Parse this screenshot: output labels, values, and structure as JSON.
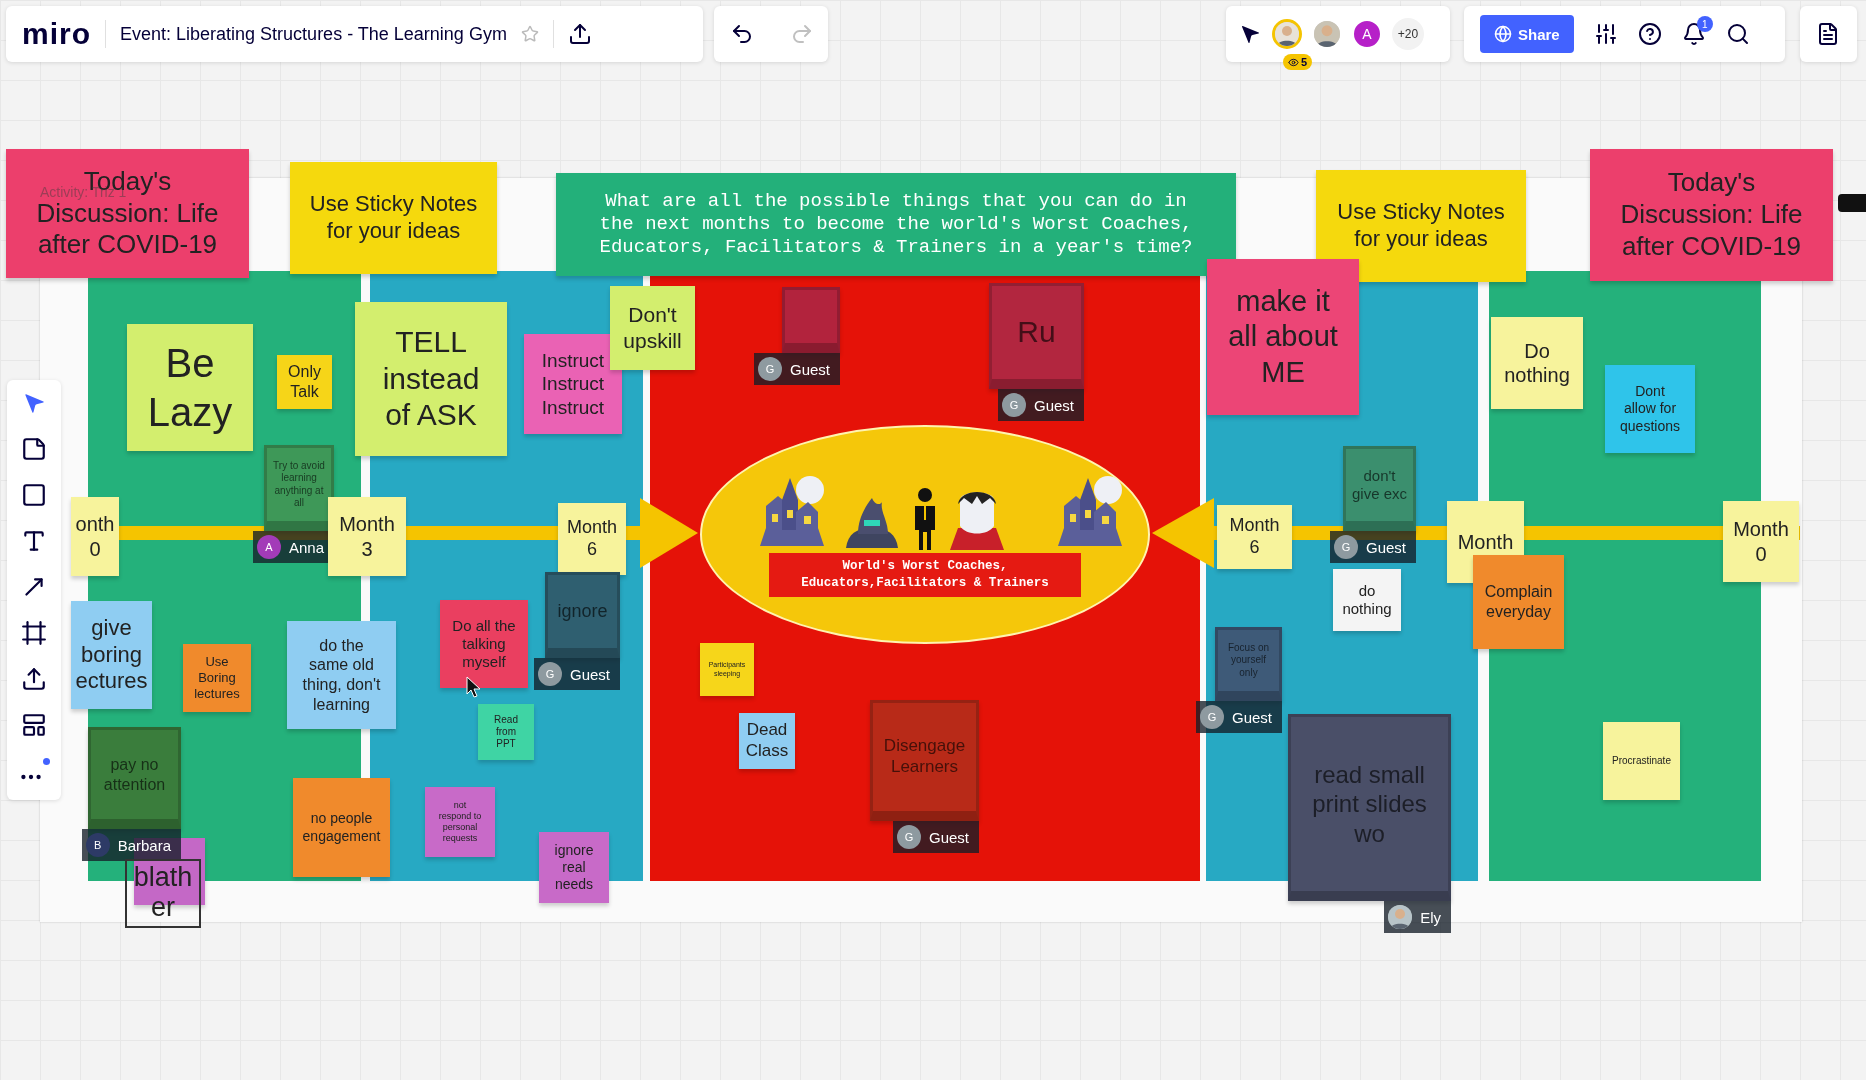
{
  "header": {
    "logo": "miro",
    "board_title": "Event: Liberating Structures - The Learning Gym",
    "starred": false
  },
  "collaborators": {
    "viewers": "5",
    "avatars": [
      {
        "kind": "photo"
      },
      {
        "kind": "photo"
      },
      {
        "kind": "initial",
        "initial": "A",
        "color": "#b620c8"
      }
    ],
    "more": "+20"
  },
  "share": {
    "label": "Share",
    "notifications": "1"
  },
  "tools": [
    {
      "kind": "select",
      "selected": true
    },
    {
      "kind": "sticky",
      "selected": false
    },
    {
      "kind": "shape",
      "selected": false
    },
    {
      "kind": "text",
      "selected": false
    },
    {
      "kind": "line",
      "selected": false
    },
    {
      "kind": "frame",
      "selected": false
    },
    {
      "kind": "upload",
      "selected": false
    },
    {
      "kind": "templates",
      "selected": false
    },
    {
      "kind": "more",
      "selected": false
    }
  ],
  "board": {
    "activity_label": "Activity: Triz 1",
    "lanes": [
      {
        "color": "#24b17b"
      },
      {
        "color": "#27a9c3"
      },
      {
        "color": "#e51208"
      },
      {
        "color": "#27a9c3"
      },
      {
        "color": "#24b17b"
      }
    ],
    "center_label": "World's Worst Coaches,\nEducators,Facilitators & Trainers",
    "notes": [
      {
        "text": "Today's\nDiscussion: Life\nafter COVID-19",
        "color": "#ec3f6c"
      },
      {
        "text": "Use Sticky Notes\nfor your ideas",
        "color": "#f5d90d"
      },
      {
        "text": "What are all the possible things that you can do in\nthe next months to become the world's Worst Coaches,\nEducators, Facilitators & Trainers in a year's time?",
        "color": "#23b07a"
      },
      {
        "text": "Use Sticky Notes\nfor your ideas",
        "color": "#f5d90d"
      },
      {
        "text": "Today's\nDiscussion: Life\nafter COVID-19",
        "color": "#ec3f6c"
      },
      {
        "text": "Be\nLazy",
        "color": "#d3ee6e"
      },
      {
        "text": "Only\nTalk",
        "color": "#f6d518"
      },
      {
        "text": "Try to avoid\nlearning\nanything at\nall",
        "color": "#3e9858",
        "author": {
          "kind": "initial",
          "name": "Anna",
          "initial": "A",
          "color": "#a33bb8"
        }
      },
      {
        "text": "TELL\ninstead\nof ASK",
        "color": "#d3ee6e"
      },
      {
        "text": "Instruct\nInstruct\nInstruct",
        "color": "#ea62b4"
      },
      {
        "text": "Don't\nupskill",
        "color": "#d3ee6e"
      },
      {
        "text": "onth\n0",
        "color": "#f7f39c"
      },
      {
        "text": "Month\n3",
        "color": "#f7f39c"
      },
      {
        "text": "Month\n6",
        "color": "#f7f39c"
      },
      {
        "text": "give\nboring\nectures",
        "color": "#8fcdf2"
      },
      {
        "text": "Use\nBoring\nlectures",
        "color": "#f08a2c"
      },
      {
        "text": "do the\nsame old\nthing, don't\nlearning",
        "color": "#8fcdf2"
      },
      {
        "text": "Do all the\ntalking\nmyself",
        "color": "#ea3f60"
      },
      {
        "text": "ignore",
        "color": "#2f5f70",
        "author": {
          "kind": "initial",
          "name": "Guest",
          "initial": "G",
          "color": "#8e9aa0"
        }
      },
      {
        "text": "Read\nfrom\nPPT",
        "color": "#3fd4a4"
      },
      {
        "color": "#c468c6"
      },
      {
        "text": "pay no\nattention",
        "color": "#3a7d3c",
        "author": {
          "kind": "initial",
          "name": "Barbara",
          "initial": "B",
          "color": "#2d3a66"
        }
      },
      {
        "text": "no people\nengagement",
        "color": "#f08a2c"
      },
      {
        "text": "not\nrespond to\npersonal\nrequests",
        "color": "#c86ac8"
      },
      {
        "text": "ignore\nreal\nneeds",
        "color": "#c86ac8"
      },
      {
        "color": "#b2233d",
        "author": {
          "kind": "initial",
          "name": "Guest",
          "initial": "G",
          "color": "#8e9aa0"
        }
      },
      {
        "text": "Ru",
        "color": "#b2263f",
        "author": {
          "kind": "initial",
          "name": "Guest",
          "initial": "G",
          "color": "#8e9aa0"
        }
      },
      {
        "text": "Participants\nsleeping",
        "color": "#f6d61a"
      },
      {
        "text": "Dead\nClass",
        "color": "#8fcdf2"
      },
      {
        "text": "Disengage\nLearners",
        "color": "#b82a18",
        "author": {
          "kind": "initial",
          "name": "Guest",
          "initial": "G",
          "color": "#8e9aa0"
        }
      },
      {
        "text": "make it\nall about\nME",
        "color": "#ec4576"
      },
      {
        "text": "Month\n6",
        "color": "#f7f39c"
      },
      {
        "text": "don't\ngive exc",
        "color": "#3b8f6e",
        "author": {
          "kind": "initial",
          "name": "Guest",
          "initial": "G",
          "color": "#8e9aa0"
        }
      },
      {
        "text": "do\nnothing",
        "color": "#f4f4f4"
      },
      {
        "text": "Focus on\nyourself\nonly",
        "color": "#3e5a78",
        "author": {
          "kind": "initial",
          "name": "Guest",
          "initial": "G",
          "color": "#8e9aa0"
        }
      },
      {
        "text": "read small\nprint slides\nwo",
        "color": "#4a4f68",
        "author": {
          "kind": "photo",
          "name": "Ely"
        }
      },
      {
        "text": "Do\nnothing",
        "color": "#f7f39c"
      },
      {
        "text": "Dont\nallow for\nquestions",
        "color": "#2fc4ea"
      },
      {
        "text": "Month",
        "color": "#f7f39c"
      },
      {
        "text": "Complain\neveryday",
        "color": "#f08a2c"
      },
      {
        "text": "Month\n0",
        "color": "#f7f39c"
      },
      {
        "text": "Procrastinate",
        "color": "#f7f39c"
      }
    ],
    "text_boxes": [
      {
        "text": "blath\ner"
      }
    ]
  }
}
